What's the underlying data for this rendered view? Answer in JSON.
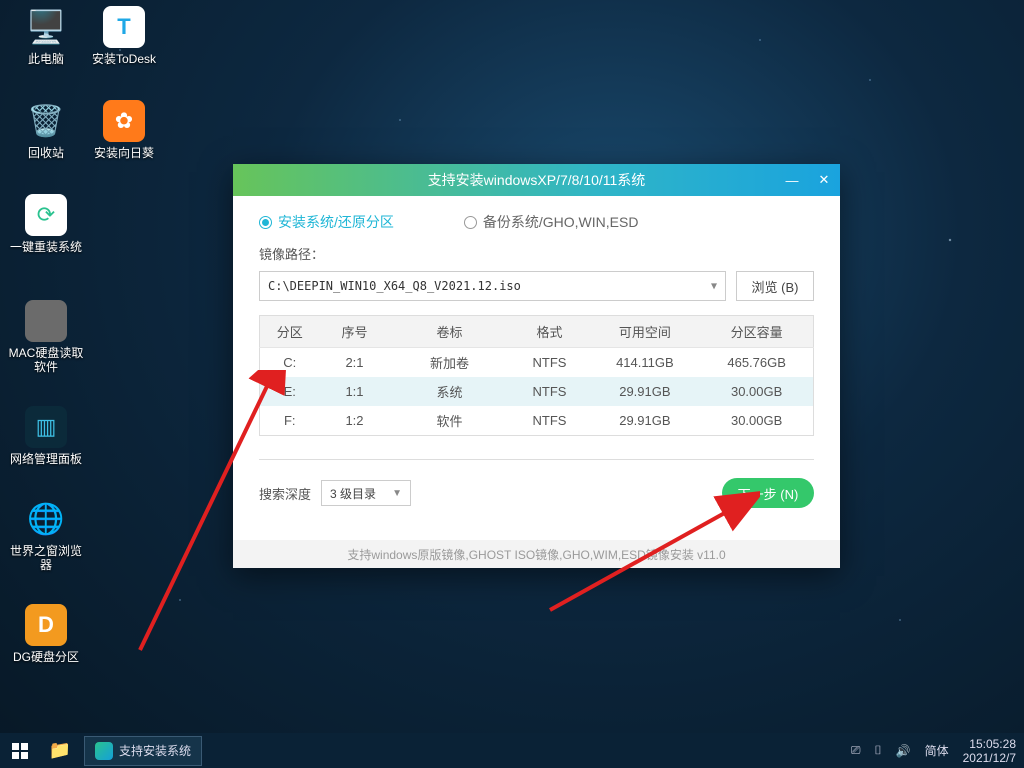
{
  "desktop_icons": [
    {
      "key": "this-pc",
      "label": "此电脑"
    },
    {
      "key": "todesk",
      "label": "安装ToDesk"
    },
    {
      "key": "recycle",
      "label": "回收站"
    },
    {
      "key": "sunflower",
      "label": "安装向日葵"
    },
    {
      "key": "oneclick",
      "label": "一键重装系统"
    },
    {
      "key": "macdisk",
      "label": "MAC硬盘读取软件"
    },
    {
      "key": "netpanel",
      "label": "网络管理面板"
    },
    {
      "key": "world-browser",
      "label": "世界之窗浏览器"
    },
    {
      "key": "dg",
      "label": "DG硬盘分区"
    }
  ],
  "taskbar": {
    "active_label": "支持安装系统",
    "ime": "简体",
    "time": "15:05:28",
    "date": "2021/12/7"
  },
  "installer": {
    "title": "支持安装windowsXP/7/8/10/11系统",
    "radio_install": "安装系统/还原分区",
    "radio_backup": "备份系统/GHO,WIN,ESD",
    "path_label": "镜像路径：",
    "path_value": "C:\\DEEPIN_WIN10_X64_Q8_V2021.12.iso",
    "browse": "浏览 (B)",
    "headers": {
      "part": "分区",
      "idx": "序号",
      "vol": "卷标",
      "fmt": "格式",
      "free": "可用空间",
      "cap": "分区容量"
    },
    "rows": [
      {
        "part": "C:",
        "idx": "2:1",
        "vol": "新加卷",
        "fmt": "NTFS",
        "free": "414.11GB",
        "cap": "465.76GB"
      },
      {
        "part": "E:",
        "idx": "1:1",
        "vol": "系统",
        "fmt": "NTFS",
        "free": "29.91GB",
        "cap": "30.00GB"
      },
      {
        "part": "F:",
        "idx": "1:2",
        "vol": "软件",
        "fmt": "NTFS",
        "free": "29.91GB",
        "cap": "30.00GB"
      }
    ],
    "depth_label": "搜索深度",
    "depth_value": "3 级目录",
    "next": "下一步 (N)",
    "footer": "支持windows原版镜像,GHOST ISO镜像,GHO,WIM,ESD镜像安装 v11.0"
  }
}
